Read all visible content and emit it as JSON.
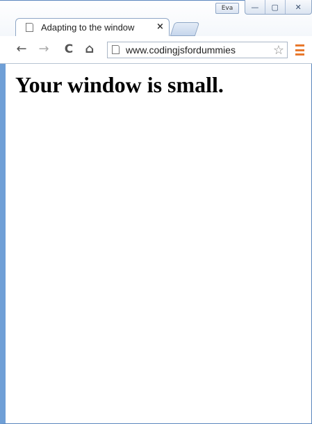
{
  "window": {
    "profile_label": "Eva",
    "minimize_glyph": "—",
    "maximize_glyph": "▢",
    "close_glyph": "✕"
  },
  "tab": {
    "title": "Adapting to the window",
    "close_glyph": "×",
    "icon": "page-icon"
  },
  "toolbar": {
    "back_glyph": "←",
    "forward_glyph": "→",
    "reload_glyph": "C",
    "home_glyph": "⌂",
    "url": "www.codingjsfordummies",
    "bookmark_glyph": "☆",
    "menu_icon": "menu-icon"
  },
  "page": {
    "heading": "Your window is small."
  },
  "colors": {
    "frame": "#6f9fd6",
    "menu_accent": "#e8782c"
  }
}
